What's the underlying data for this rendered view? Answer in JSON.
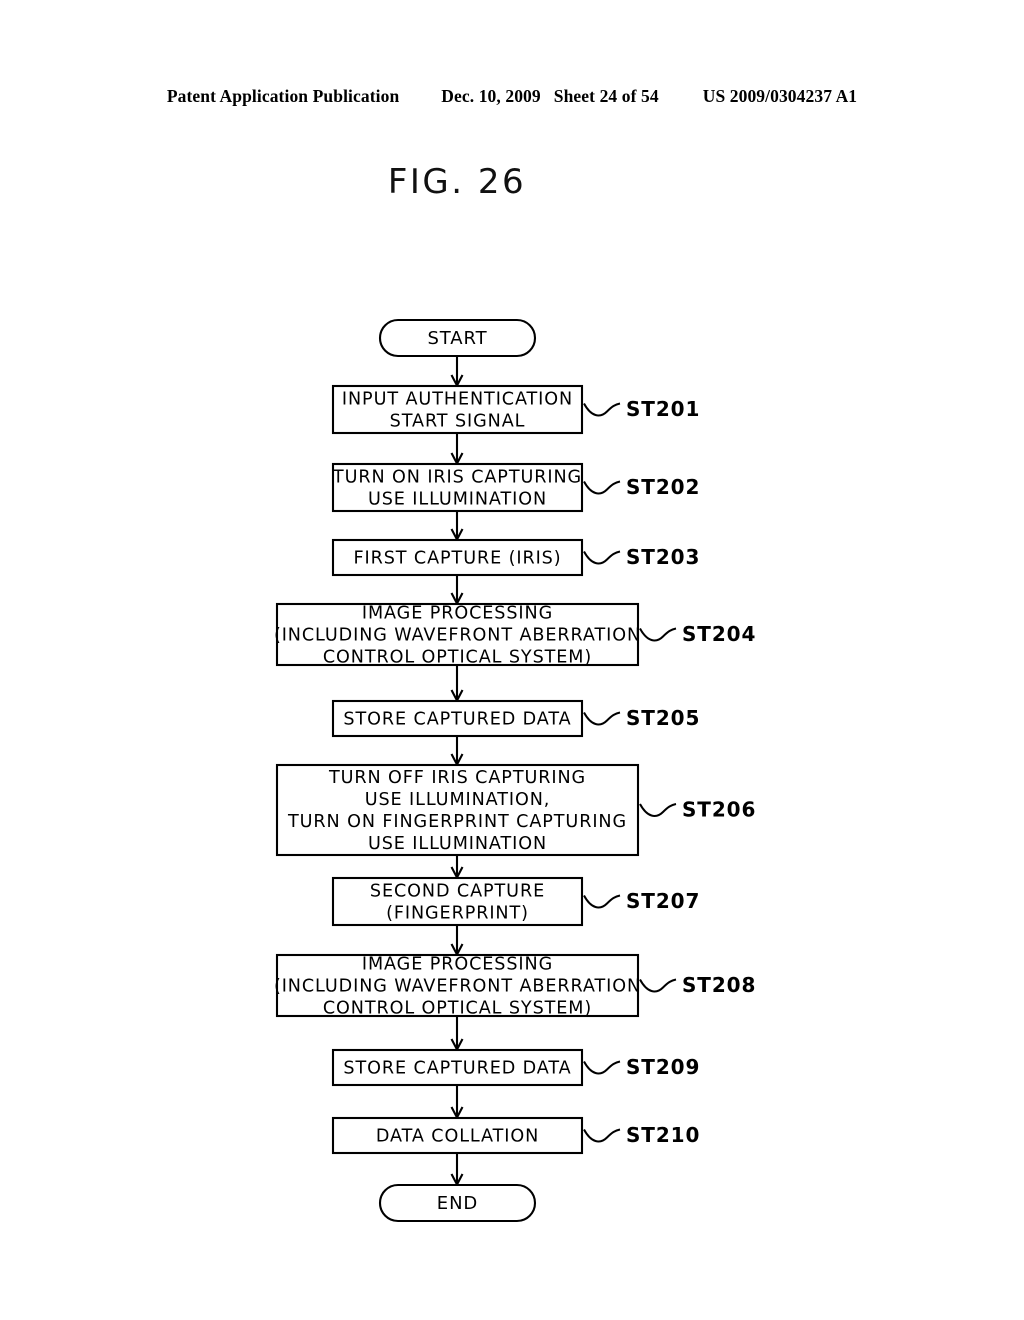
{
  "header": {
    "publication": "Patent Application Publication",
    "date": "Dec. 10, 2009",
    "sheet": "Sheet 24 of 54",
    "patent_number": "US 2009/0304237 A1"
  },
  "figure": {
    "title": "FIG. 26"
  },
  "flowchart": {
    "start_label": "START",
    "end_label": "END",
    "steps": [
      {
        "id": "ST201",
        "lines": [
          "INPUT  AUTHENTICATION",
          "START  SIGNAL"
        ],
        "width": "narrow"
      },
      {
        "id": "ST202",
        "lines": [
          "TURN  ON  IRIS  CAPTURING",
          "USE  ILLUMINATION"
        ],
        "width": "narrow"
      },
      {
        "id": "ST203",
        "lines": [
          "FIRST  CAPTURE (IRIS)"
        ],
        "width": "narrow"
      },
      {
        "id": "ST204",
        "lines": [
          "IMAGE  PROCESSING",
          "(INCLUDING  WAVEFRONT   ABERRATION",
          "CONTROL  OPTICAL  SYSTEM)"
        ],
        "width": "wide"
      },
      {
        "id": "ST205",
        "lines": [
          "STORE  CAPTURED  DATA"
        ],
        "width": "narrow"
      },
      {
        "id": "ST206",
        "lines": [
          "TURN  OFF  IRIS  CAPTURING",
          "USE  ILLUMINATION,",
          "TURN  ON  FINGERPRINT  CAPTURING",
          "USE  ILLUMINATION"
        ],
        "width": "wide"
      },
      {
        "id": "ST207",
        "lines": [
          "SECOND  CAPTURE",
          "(FINGERPRINT)"
        ],
        "width": "narrow"
      },
      {
        "id": "ST208",
        "lines": [
          "IMAGE  PROCESSING",
          "(INCLUDING  WAVEFRONT  ABERRATION",
          "CONTROL  OPTICAL  SYSTEM)"
        ],
        "width": "wide"
      },
      {
        "id": "ST209",
        "lines": [
          "STORE  CAPTURED  DATA"
        ],
        "width": "narrow"
      },
      {
        "id": "ST210",
        "lines": [
          "DATA  COLLATION"
        ],
        "width": "narrow"
      }
    ]
  },
  "colors": {
    "ink": "#000000",
    "paper": "#ffffff"
  }
}
